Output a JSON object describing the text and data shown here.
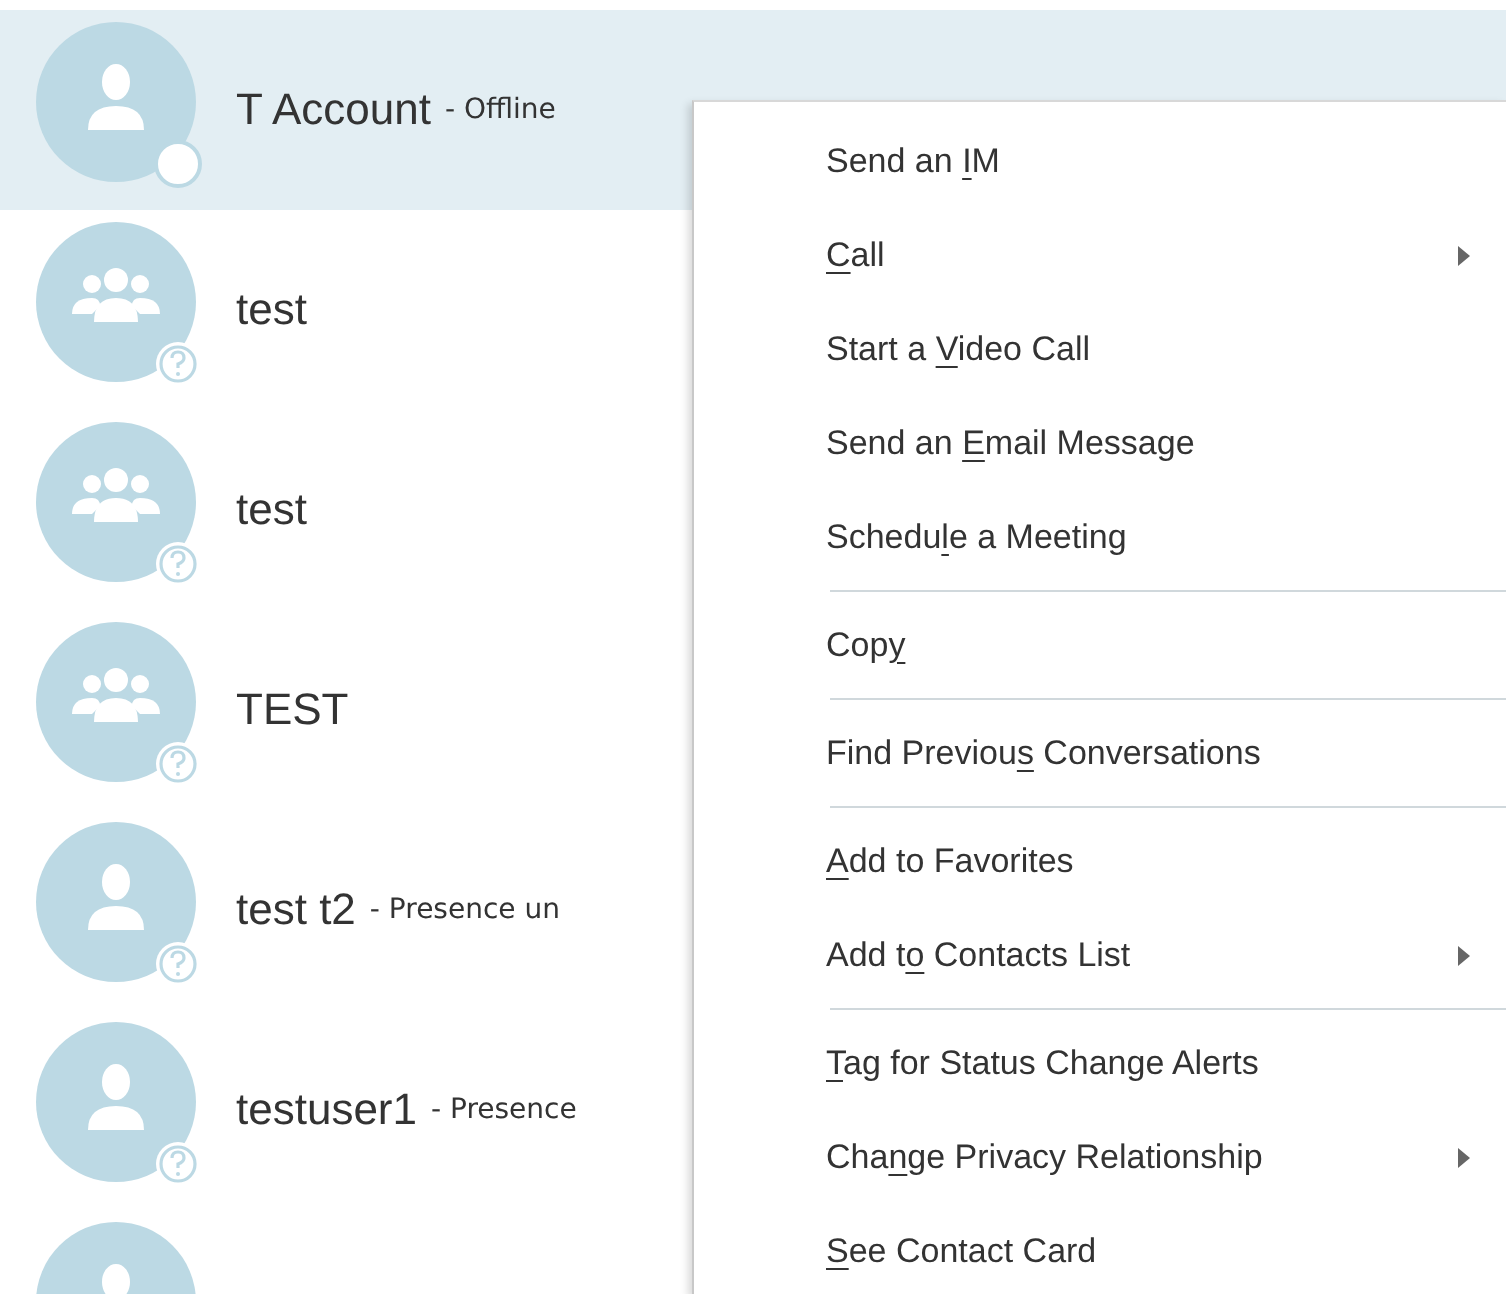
{
  "contacts": [
    {
      "name": "T Account",
      "status": "- Offline",
      "kind": "person",
      "offline": true,
      "selected": true
    },
    {
      "name": "test",
      "kind": "group",
      "offline": false,
      "selected": false
    },
    {
      "name": "test",
      "kind": "group",
      "offline": false,
      "selected": false
    },
    {
      "name": "TEST",
      "kind": "group",
      "offline": false,
      "selected": false
    },
    {
      "name": "test t2",
      "status": "- Presence un",
      "kind": "person",
      "offline": false,
      "selected": false
    },
    {
      "name": "testuser1",
      "status": "- Presence",
      "kind": "person",
      "offline": false,
      "selected": false
    },
    {
      "kind": "person",
      "selected": false
    }
  ],
  "context_menu": {
    "items": [
      {
        "kind": "item",
        "before": "Send an ",
        "key": "I",
        "after": "M",
        "submenu": false
      },
      {
        "kind": "item",
        "key": "C",
        "after": "all",
        "submenu": true
      },
      {
        "kind": "item",
        "before": "Start a ",
        "key": "V",
        "after": "ideo Call",
        "submenu": false
      },
      {
        "kind": "item",
        "before": "Send an ",
        "key": "E",
        "after": "mail Message",
        "submenu": false
      },
      {
        "kind": "item",
        "before": "Schedu",
        "key": "l",
        "after": "e a Meeting",
        "submenu": false
      },
      {
        "kind": "separator"
      },
      {
        "kind": "item",
        "before": "Cop",
        "key": "y",
        "submenu": false
      },
      {
        "kind": "separator"
      },
      {
        "kind": "item",
        "before": "Find Previou",
        "key": "s",
        "after": " Conversations",
        "submenu": false
      },
      {
        "kind": "separator"
      },
      {
        "kind": "item",
        "key": "A",
        "after": "dd to Favorites",
        "submenu": false
      },
      {
        "kind": "item",
        "before": "Add t",
        "key": "o",
        "after": " Contacts List",
        "submenu": true
      },
      {
        "kind": "separator"
      },
      {
        "kind": "item",
        "key": "T",
        "after": "ag for Status Change Alerts",
        "submenu": false
      },
      {
        "kind": "item",
        "before": "Cha",
        "key": "n",
        "after": "ge Privacy Relationship",
        "submenu": true
      },
      {
        "kind": "item",
        "key": "S",
        "after": "ee Contact Card",
        "submenu": false
      }
    ]
  }
}
